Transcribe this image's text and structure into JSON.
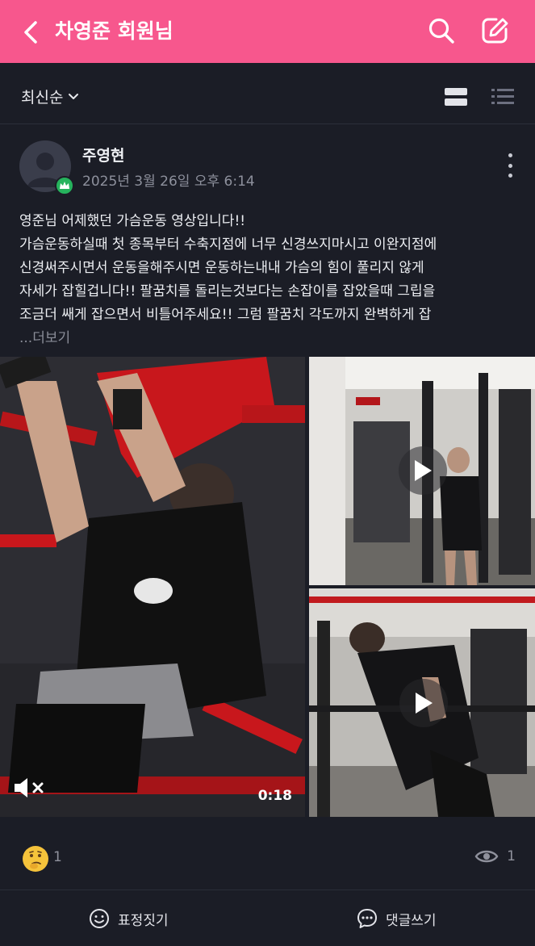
{
  "header": {
    "title": "차영준 회원님",
    "icons": [
      "back-icon",
      "search-icon",
      "edit-icon"
    ],
    "accent": "#f7578d"
  },
  "filter": {
    "sort_label": "최신순",
    "icons": [
      "chevron-down-icon",
      "card-view-icon",
      "list-view-icon"
    ]
  },
  "post": {
    "author": "주영현",
    "date": "2025년 3월 26일 오후 6:14",
    "badge_color": "#26b35d",
    "lines": [
      "영준님 어제했던 가슴운동 영상입니다!!",
      "가슴운동하실때 첫 종목부터 수축지점에 너무 신경쓰지마시고 이완지점에",
      "신경써주시면서 운동을해주시면 운동하는내내 가슴의 힘이 풀리지 않게",
      "자세가 잡힐겁니다!! 팔꿈치를 돌리는것보다는 손잡이를 잡았을때 그립을",
      "조금더 쌔게 잡으면서 비틀어주세요!! 그럼 팔꿈치 각도까지 완벽하게 잡"
    ],
    "see_more": "...더보기",
    "video_duration": "0:18"
  },
  "stats": {
    "reaction_count": "1",
    "view_count": "1"
  },
  "actions": {
    "react_label": "표정짓기",
    "comment_label": "댓글쓰기"
  }
}
